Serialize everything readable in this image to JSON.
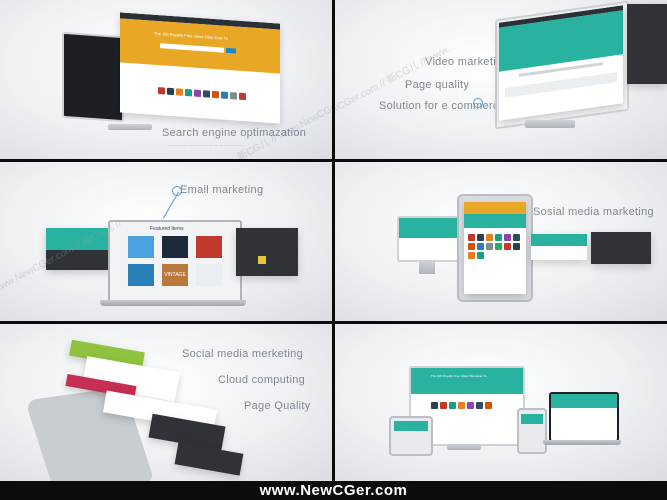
{
  "panels": {
    "p1": {
      "caption": "Search engine optimazation",
      "hero_title": "The 100 Royalty Free Video Files Ever To"
    },
    "p2": {
      "items": [
        "Video marketing",
        "Page quality",
        "Solution for e commerce"
      ]
    },
    "p3": {
      "caption": "Email marketing",
      "featured": "Featured Items",
      "badge": "VINTAGE"
    },
    "p4": {
      "caption": "Sosial media marketing"
    },
    "p5": {
      "items": [
        "Social media merketing",
        "Cloud computing",
        "Page Quality"
      ]
    },
    "p6": {
      "hero_title": "The 100 Royalty Free Video Files Ever To"
    }
  },
  "watermarks": [
    "www.NewCGer.com // 新CG儿 // www.",
    "www.NewCGer.com // 新CG儿 //",
    "新CG儿 // www.NewCGer.com"
  ],
  "footer": {
    "site": "www.NewCGer.com"
  },
  "colors": {
    "yellow": "#e8a825",
    "teal": "#29b2a0",
    "green": "#8fc23e",
    "crimson": "#c42f53"
  }
}
